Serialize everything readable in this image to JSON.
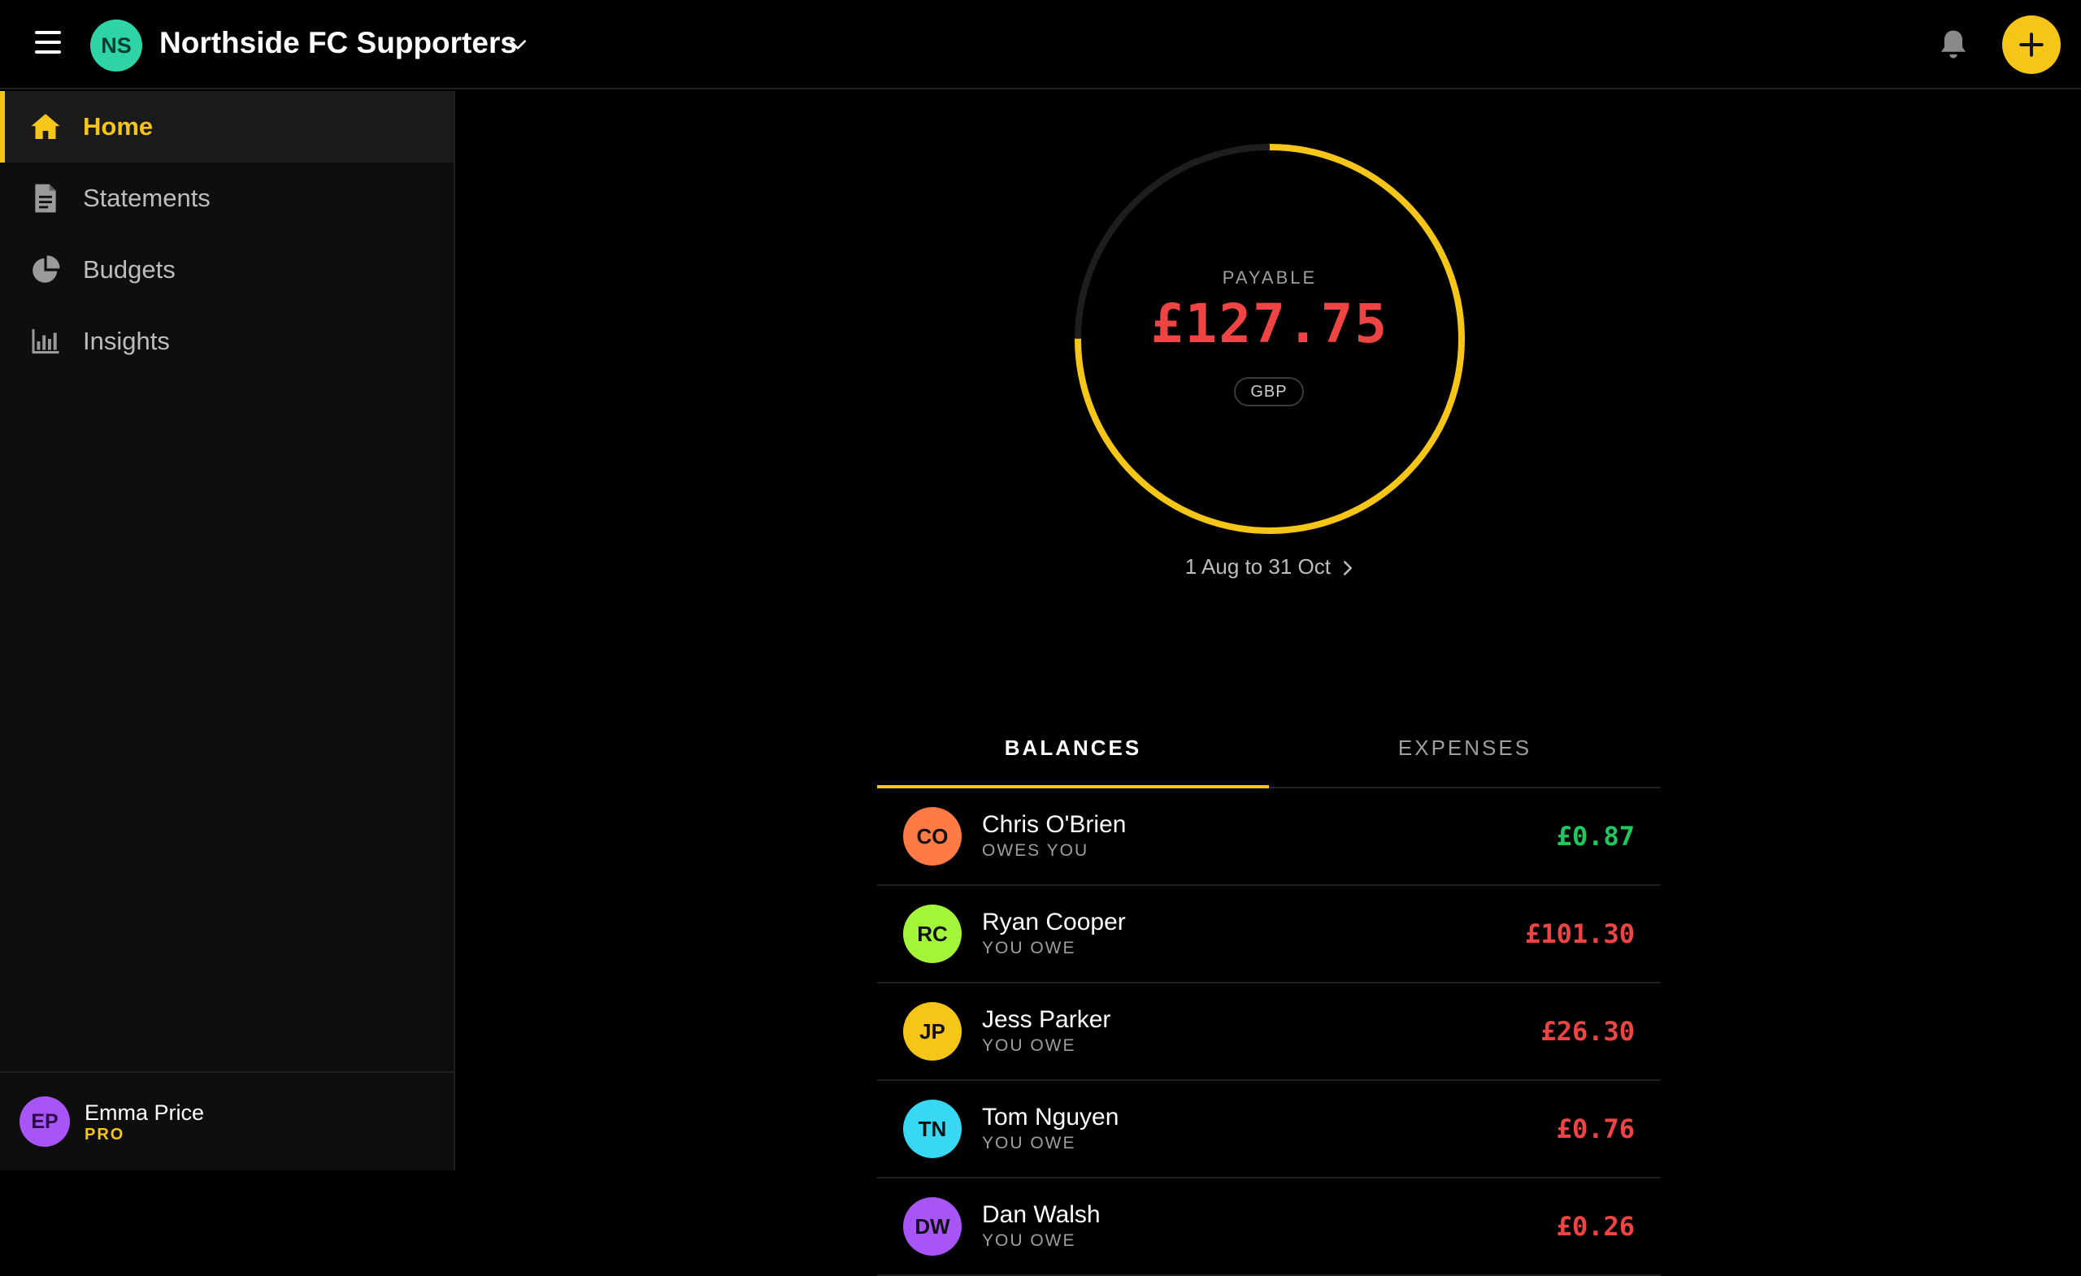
{
  "header": {
    "group_initials": "NS",
    "group_name": "Northside FC Supporters",
    "group_avatar_color": "#2ed3a6",
    "accent_color": "#f5c518",
    "icons": [
      "menu-icon",
      "chevron-down-icon",
      "bell-icon",
      "plus-icon"
    ]
  },
  "sidebar": {
    "items": [
      {
        "label": "Home",
        "icon": "home-icon",
        "active": true
      },
      {
        "label": "Statements",
        "icon": "document-icon",
        "active": false
      },
      {
        "label": "Budgets",
        "icon": "pie-chart-icon",
        "active": false
      },
      {
        "label": "Insights",
        "icon": "bar-chart-icon",
        "active": false
      }
    ],
    "user": {
      "initials": "EP",
      "name": "Emma Price",
      "plan": "PRO",
      "avatar_color": "#a855f7"
    }
  },
  "summary": {
    "label": "PAYABLE",
    "amount": "£127.75",
    "currency": "GBP",
    "period": "1 Aug to 31 Oct",
    "progress_fraction": 0.75,
    "progress_color": "#f5c518",
    "amount_color": "#ef4444"
  },
  "tabs": [
    {
      "label": "BALANCES",
      "active": true
    },
    {
      "label": "EXPENSES",
      "active": false
    }
  ],
  "balances": [
    {
      "initials": "CO",
      "name": "Chris O'Brien",
      "status": "OWES YOU",
      "amount": "£0.87",
      "avatar_color": "#ff7a45",
      "amount_color": "#22c55e"
    },
    {
      "initials": "RC",
      "name": "Ryan Cooper",
      "status": "YOU OWE",
      "amount": "£101.30",
      "avatar_color": "#a3f53a",
      "amount_color": "#ef4444"
    },
    {
      "initials": "JP",
      "name": "Jess Parker",
      "status": "YOU OWE",
      "amount": "£26.30",
      "avatar_color": "#f5c518",
      "amount_color": "#ef4444"
    },
    {
      "initials": "TN",
      "name": "Tom Nguyen",
      "status": "YOU OWE",
      "amount": "£0.76",
      "avatar_color": "#38d8f5",
      "amount_color": "#ef4444"
    },
    {
      "initials": "DW",
      "name": "Dan Walsh",
      "status": "YOU OWE",
      "amount": "£0.26",
      "avatar_color": "#a855f7",
      "amount_color": "#ef4444"
    }
  ]
}
